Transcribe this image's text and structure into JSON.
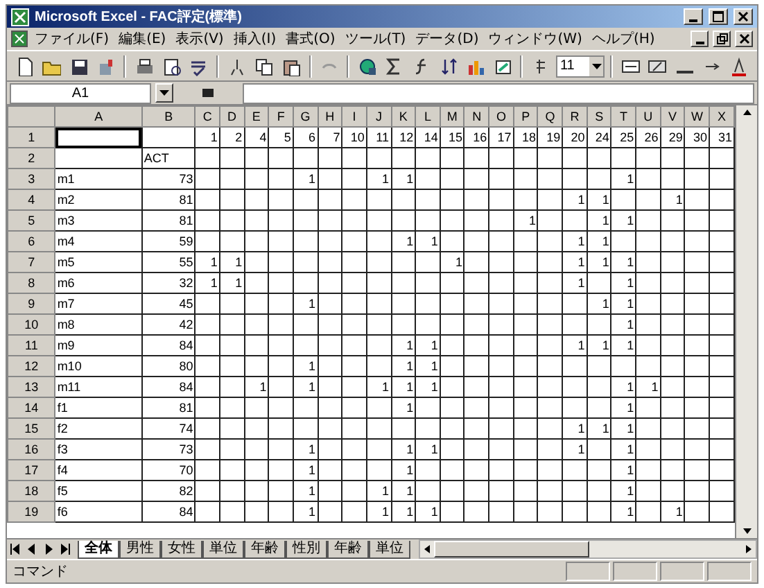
{
  "window": {
    "title": "Microsoft Excel - FAC評定(標準)"
  },
  "menu": [
    "ファイル(F)",
    "編集(E)",
    "表示(V)",
    "挿入(I)",
    "書式(O)",
    "ツール(T)",
    "データ(D)",
    "ウィンドウ(W)",
    "ヘルプ(H)"
  ],
  "toolbar": {
    "font_size": "11"
  },
  "formula_bar": {
    "name_box": "A1"
  },
  "sheet": {
    "columns": [
      "A",
      "B",
      "C",
      "D",
      "E",
      "F",
      "G",
      "H",
      "I",
      "J",
      "K",
      "L",
      "M",
      "N",
      "O",
      "P",
      "Q",
      "R",
      "S",
      "T",
      "U",
      "V",
      "W",
      "X"
    ],
    "rows": [
      {
        "header": "1",
        "cells": [
          {
            "active": true
          },
          null,
          "1",
          "2",
          "4",
          "5",
          "6",
          "7",
          "10",
          "11",
          "12",
          "14",
          "15",
          "16",
          "17",
          "18",
          "19",
          "20",
          "24",
          "25",
          "26",
          "29",
          "30",
          "31"
        ]
      },
      {
        "header": "2",
        "cells": [
          null,
          "ACT",
          null,
          null,
          null,
          null,
          null,
          null,
          null,
          null,
          null,
          null,
          null,
          null,
          null,
          null,
          null,
          null,
          null,
          null,
          null,
          null,
          null,
          null
        ]
      },
      {
        "header": "3",
        "cells": [
          "m1",
          "73",
          null,
          null,
          null,
          null,
          "1",
          null,
          null,
          "1",
          "1",
          null,
          null,
          null,
          null,
          null,
          null,
          null,
          null,
          "1",
          null,
          null,
          null,
          null
        ]
      },
      {
        "header": "4",
        "cells": [
          "m2",
          "81",
          null,
          null,
          null,
          null,
          null,
          null,
          null,
          null,
          null,
          null,
          null,
          null,
          null,
          null,
          null,
          "1",
          "1",
          null,
          null,
          "1",
          null,
          null
        ]
      },
      {
        "header": "5",
        "cells": [
          "m3",
          "81",
          null,
          null,
          null,
          null,
          null,
          null,
          null,
          null,
          null,
          null,
          null,
          null,
          null,
          "1",
          null,
          null,
          "1",
          "1",
          null,
          null,
          null,
          null
        ]
      },
      {
        "header": "6",
        "cells": [
          "m4",
          "59",
          null,
          null,
          null,
          null,
          null,
          null,
          null,
          null,
          "1",
          "1",
          null,
          null,
          null,
          null,
          null,
          "1",
          "1",
          null,
          null,
          null,
          null,
          null
        ]
      },
      {
        "header": "7",
        "cells": [
          "m5",
          "55",
          "1",
          "1",
          null,
          null,
          null,
          null,
          null,
          null,
          null,
          null,
          "1",
          null,
          null,
          null,
          null,
          "1",
          "1",
          "1",
          null,
          null,
          null,
          null
        ]
      },
      {
        "header": "8",
        "cells": [
          "m6",
          "32",
          "1",
          "1",
          null,
          null,
          null,
          null,
          null,
          null,
          null,
          null,
          null,
          null,
          null,
          null,
          null,
          "1",
          null,
          "1",
          null,
          null,
          null,
          null
        ]
      },
      {
        "header": "9",
        "cells": [
          "m7",
          "45",
          null,
          null,
          null,
          null,
          "1",
          null,
          null,
          null,
          null,
          null,
          null,
          null,
          null,
          null,
          null,
          null,
          "1",
          "1",
          null,
          null,
          null,
          null
        ]
      },
      {
        "header": "10",
        "cells": [
          "m8",
          "42",
          null,
          null,
          null,
          null,
          null,
          null,
          null,
          null,
          null,
          null,
          null,
          null,
          null,
          null,
          null,
          null,
          null,
          "1",
          null,
          null,
          null,
          null
        ]
      },
      {
        "header": "11",
        "cells": [
          "m9",
          "84",
          null,
          null,
          null,
          null,
          null,
          null,
          null,
          null,
          "1",
          "1",
          null,
          null,
          null,
          null,
          null,
          "1",
          "1",
          "1",
          null,
          null,
          null,
          null
        ]
      },
      {
        "header": "12",
        "cells": [
          "m10",
          "80",
          null,
          null,
          null,
          null,
          "1",
          null,
          null,
          null,
          "1",
          "1",
          null,
          null,
          null,
          null,
          null,
          null,
          null,
          null,
          null,
          null,
          null,
          null
        ]
      },
      {
        "header": "13",
        "cells": [
          "m11",
          "84",
          null,
          null,
          "1",
          null,
          "1",
          null,
          null,
          "1",
          "1",
          "1",
          null,
          null,
          null,
          null,
          null,
          null,
          null,
          "1",
          "1",
          null,
          null,
          null
        ]
      },
      {
        "header": "14",
        "cells": [
          "f1",
          "81",
          null,
          null,
          null,
          null,
          null,
          null,
          null,
          null,
          "1",
          null,
          null,
          null,
          null,
          null,
          null,
          null,
          null,
          "1",
          null,
          null,
          null,
          null
        ]
      },
      {
        "header": "15",
        "cells": [
          "f2",
          "74",
          null,
          null,
          null,
          null,
          null,
          null,
          null,
          null,
          null,
          null,
          null,
          null,
          null,
          null,
          null,
          "1",
          "1",
          "1",
          null,
          null,
          null,
          null
        ]
      },
      {
        "header": "16",
        "cells": [
          "f3",
          "73",
          null,
          null,
          null,
          null,
          "1",
          null,
          null,
          null,
          "1",
          "1",
          null,
          null,
          null,
          null,
          null,
          "1",
          null,
          "1",
          null,
          null,
          null,
          null
        ]
      },
      {
        "header": "17",
        "cells": [
          "f4",
          "70",
          null,
          null,
          null,
          null,
          "1",
          null,
          null,
          null,
          "1",
          null,
          null,
          null,
          null,
          null,
          null,
          null,
          null,
          "1",
          null,
          null,
          null,
          null
        ]
      },
      {
        "header": "18",
        "cells": [
          "f5",
          "82",
          null,
          null,
          null,
          null,
          "1",
          null,
          null,
          "1",
          "1",
          null,
          null,
          null,
          null,
          null,
          null,
          null,
          null,
          "1",
          null,
          null,
          null,
          null
        ]
      },
      {
        "header": "19",
        "cells": [
          "f6",
          "84",
          null,
          null,
          null,
          null,
          "1",
          null,
          null,
          "1",
          "1",
          "1",
          null,
          null,
          null,
          null,
          null,
          null,
          null,
          "1",
          null,
          "1",
          null,
          null
        ]
      }
    ]
  },
  "sheet_tabs": [
    {
      "label": "全体",
      "selected": true
    },
    {
      "label": "男性",
      "selected": false
    },
    {
      "label": "女性",
      "selected": false
    },
    {
      "label": "単位",
      "selected": false
    },
    {
      "label": "年齢",
      "selected": false
    },
    {
      "label": "性別",
      "selected": false
    },
    {
      "label": "年齢",
      "selected": false
    },
    {
      "label": "単位",
      "selected": false
    }
  ],
  "status_bar": {
    "text": "コマンド"
  }
}
